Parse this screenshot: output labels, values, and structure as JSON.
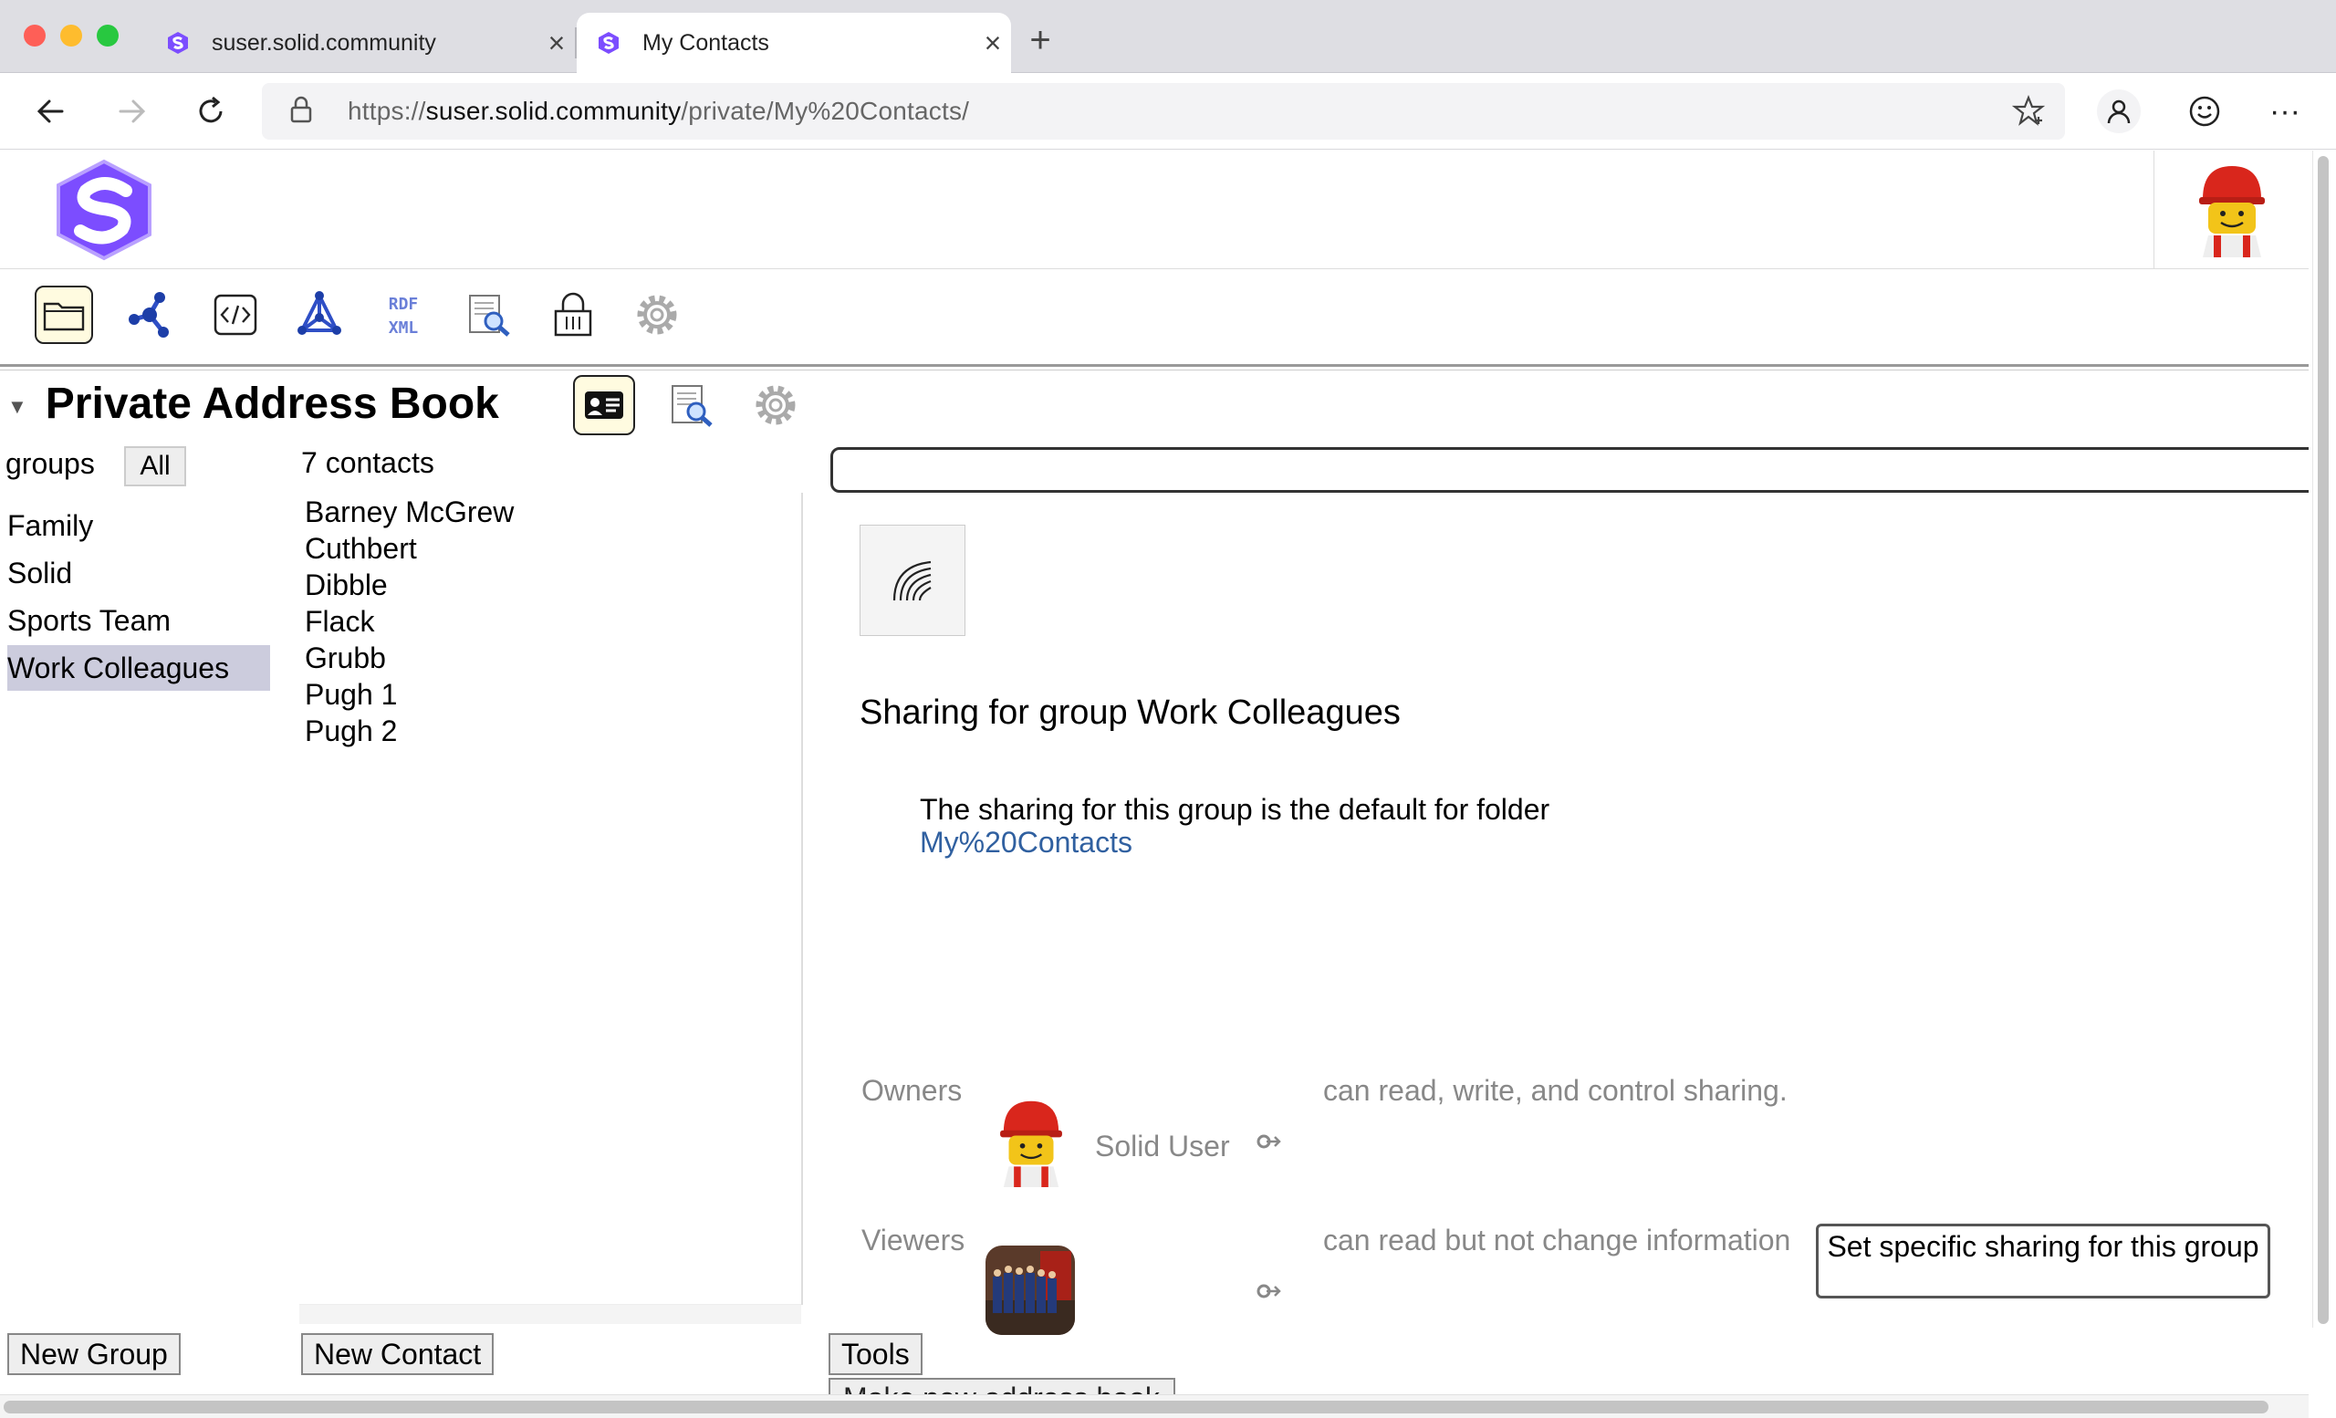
{
  "browser": {
    "tabs": [
      {
        "title": "suser.solid.community",
        "active": false
      },
      {
        "title": "My Contacts",
        "active": true
      }
    ],
    "url_scheme": "https://",
    "url_host": "suser.solid.community",
    "url_path": "/private/My%20Contacts/",
    "colors": {
      "close": "#fe5f57",
      "minimize": "#febc2e",
      "zoom": "#28c840",
      "solid_purple": "#7c4dff"
    }
  },
  "toolbar_icons": [
    "folder-icon",
    "network-icon",
    "source-code-icon",
    "graph-icon",
    "rdf-xml-icon",
    "inspect-icon",
    "lock-icon",
    "settings-icon"
  ],
  "address_book": {
    "title": "Private Address Book",
    "groups_label": "groups",
    "all_button": "All",
    "groups": [
      {
        "label": "Family",
        "selected": false
      },
      {
        "label": "Solid",
        "selected": false
      },
      {
        "label": "Sports Team",
        "selected": false
      },
      {
        "label": "Work Colleagues",
        "selected": true
      }
    ],
    "contact_count": "7 contacts",
    "contacts": [
      "Barney McGrew",
      "Cuthbert",
      "Dibble",
      "Flack",
      "Grubb",
      "Pugh 1",
      "Pugh 2"
    ],
    "new_group_button": "New Group",
    "new_contact_button": "New Contact",
    "tools_button": "Tools",
    "make_new_button": "Make new address book"
  },
  "sharing": {
    "title": "Sharing for group Work Colleagues",
    "default_text": "The sharing for this group is the default for folder",
    "folder_link": "My%20Contacts",
    "owners_label": "Owners",
    "owners_desc": "can read, write, and control sharing.",
    "owner_name": "Solid User",
    "viewers_label": "Viewers",
    "viewers_desc": "can read but not change information",
    "set_specific_button": "Set specific sharing for this group"
  }
}
